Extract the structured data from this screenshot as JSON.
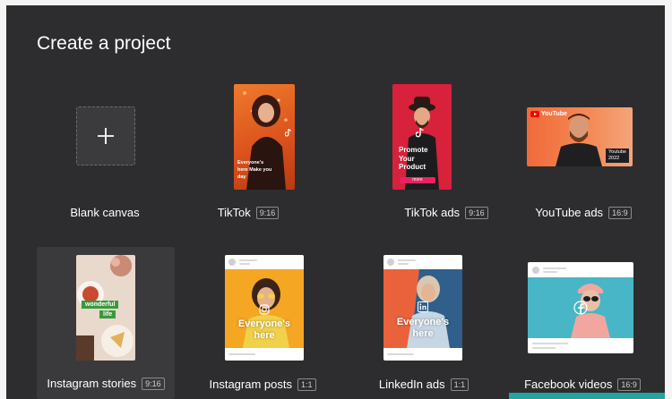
{
  "page": {
    "title": "Create a project"
  },
  "templates": [
    {
      "label": "Blank canvas",
      "ratio": ""
    },
    {
      "label": "TikTok",
      "ratio": "9:16"
    },
    {
      "label": "TikTok ads",
      "ratio": "9:16"
    },
    {
      "label": "YouTube ads",
      "ratio": "16:9"
    },
    {
      "label": "Instagram stories",
      "ratio": "9:16"
    },
    {
      "label": "Instagram posts",
      "ratio": "1:1"
    },
    {
      "label": "LinkedIn ads",
      "ratio": "1:1"
    },
    {
      "label": "Facebook videos",
      "ratio": "16:9"
    }
  ],
  "thumbnails": {
    "tiktok": {
      "text": "Everyone's here Make you day"
    },
    "tiktok_ads": {
      "text1": "Promote",
      "text2": "Your",
      "text3": "Product",
      "button": "more"
    },
    "youtube_ads": {
      "brand": "YouTube",
      "badge1": "Youtube",
      "badge2": "2022"
    },
    "instagram_stories": {
      "text1": "wonderful",
      "text2": "life"
    },
    "instagram_posts": {
      "text1": "Everyone's",
      "text2": "here"
    },
    "linkedin_ads": {
      "text1": "Everyone's",
      "text2": "here"
    }
  },
  "colors": {
    "panel_bg": "#2d2d2f",
    "accent_pink": "#e8235f",
    "tiktok_orange": "#e65a1e",
    "youtube_red": "#ff0000",
    "teal_accent": "#24a3a0"
  },
  "icons": [
    "plus-icon",
    "tiktok-icon",
    "youtube-icon",
    "instagram-icon",
    "linkedin-icon",
    "facebook-icon"
  ]
}
